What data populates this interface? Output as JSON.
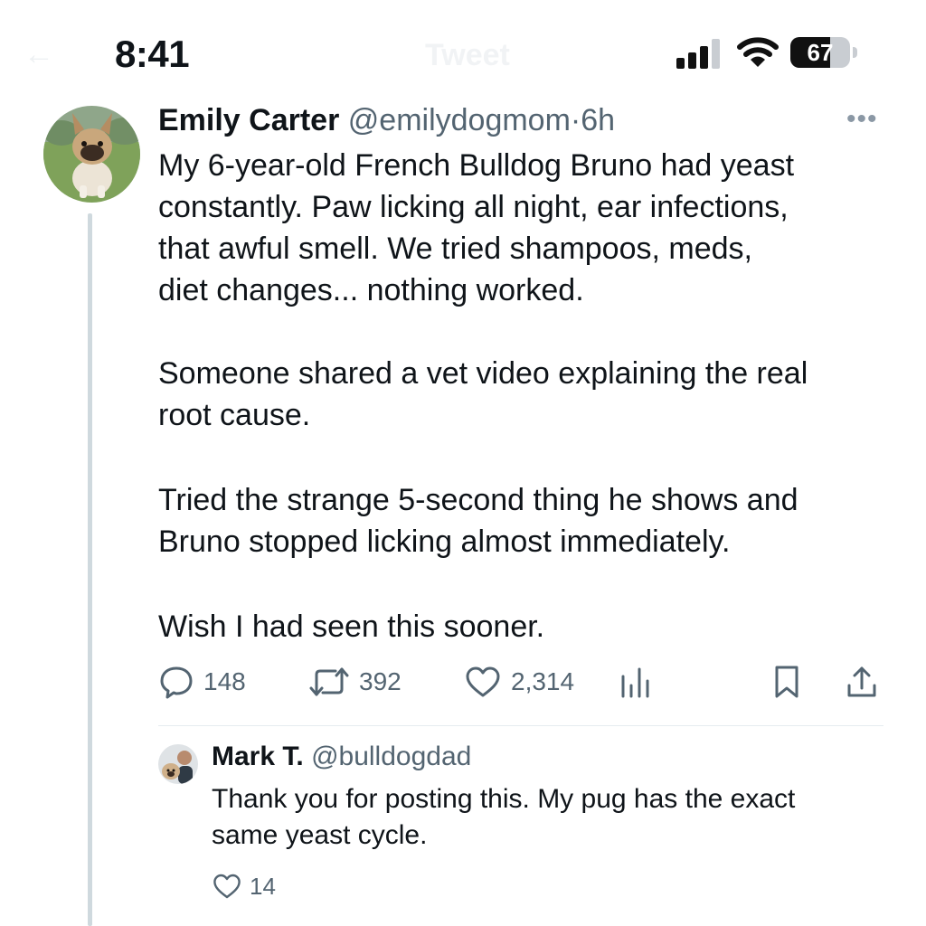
{
  "status_bar": {
    "time": "8:41",
    "battery_percent": "67",
    "battery_level": 0.67
  },
  "nav": {
    "title": "Tweet",
    "back_icon": "arrow-left-icon"
  },
  "tweet": {
    "author_name": "Emily Carter",
    "author_handle": "@emilydogmom",
    "separator": "·",
    "time": "6h",
    "paragraphs": [
      "My 6-year-old French Bulldog Bruno had yeast\nconstantly. Paw licking all night, ear infections,\nthat awful smell. We tried shampoos, meds,\ndiet changes... nothing worked.",
      "Someone shared a vet video explaining the real\nroot cause.",
      "Tried the strange 5-second thing he shows and\nBruno stopped licking almost immediately.",
      "Wish I had seen this sooner."
    ],
    "replies": "148",
    "retweets": "392",
    "likes": "2,314",
    "icons": {
      "reply": "comment-bubble-icon",
      "retweet": "retweet-icon",
      "like": "heart-icon",
      "views": "bar-chart-icon",
      "bookmark": "bookmark-icon",
      "share": "share-icon",
      "more": "more-dots-icon"
    }
  },
  "reply": {
    "author_name": "Mark T.",
    "author_handle": "@bulldogdad",
    "text": "Thank you for posting this. My pug has the exact\nsame yeast cycle.",
    "likes": "14"
  },
  "colors": {
    "text": "#0f1419",
    "secondary": "#536471",
    "thread_line": "#cfd9de",
    "divider": "#e6ecf0"
  }
}
